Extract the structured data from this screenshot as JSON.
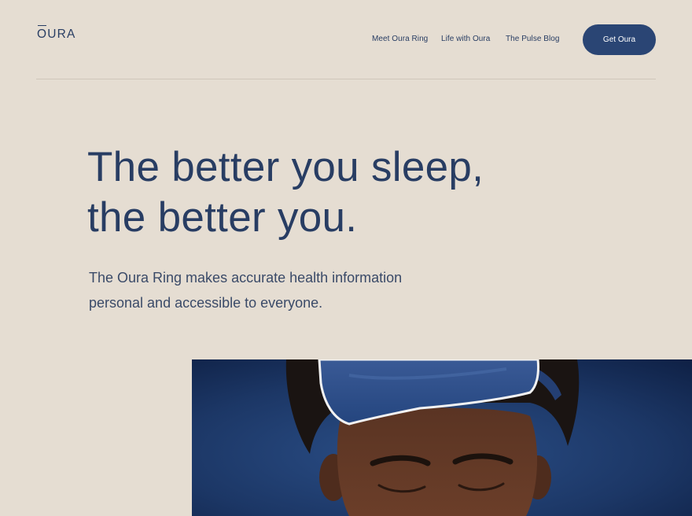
{
  "header": {
    "logo_text_o": "O",
    "logo_text_rest": "URA",
    "nav": [
      {
        "label": "Meet Oura Ring"
      },
      {
        "label": "Life with Oura"
      },
      {
        "label": "The Pulse Blog"
      }
    ],
    "cta_label": "Get Oura"
  },
  "hero": {
    "headline_line1": "The better you sleep,",
    "headline_line2": "the better you.",
    "subtext_line1": "The Oura Ring makes accurate health information",
    "subtext_line2": "personal and accessible to everyone."
  },
  "colors": {
    "background": "#e5ddd2",
    "brand_navy": "#283d63",
    "button": "#2a4574"
  }
}
